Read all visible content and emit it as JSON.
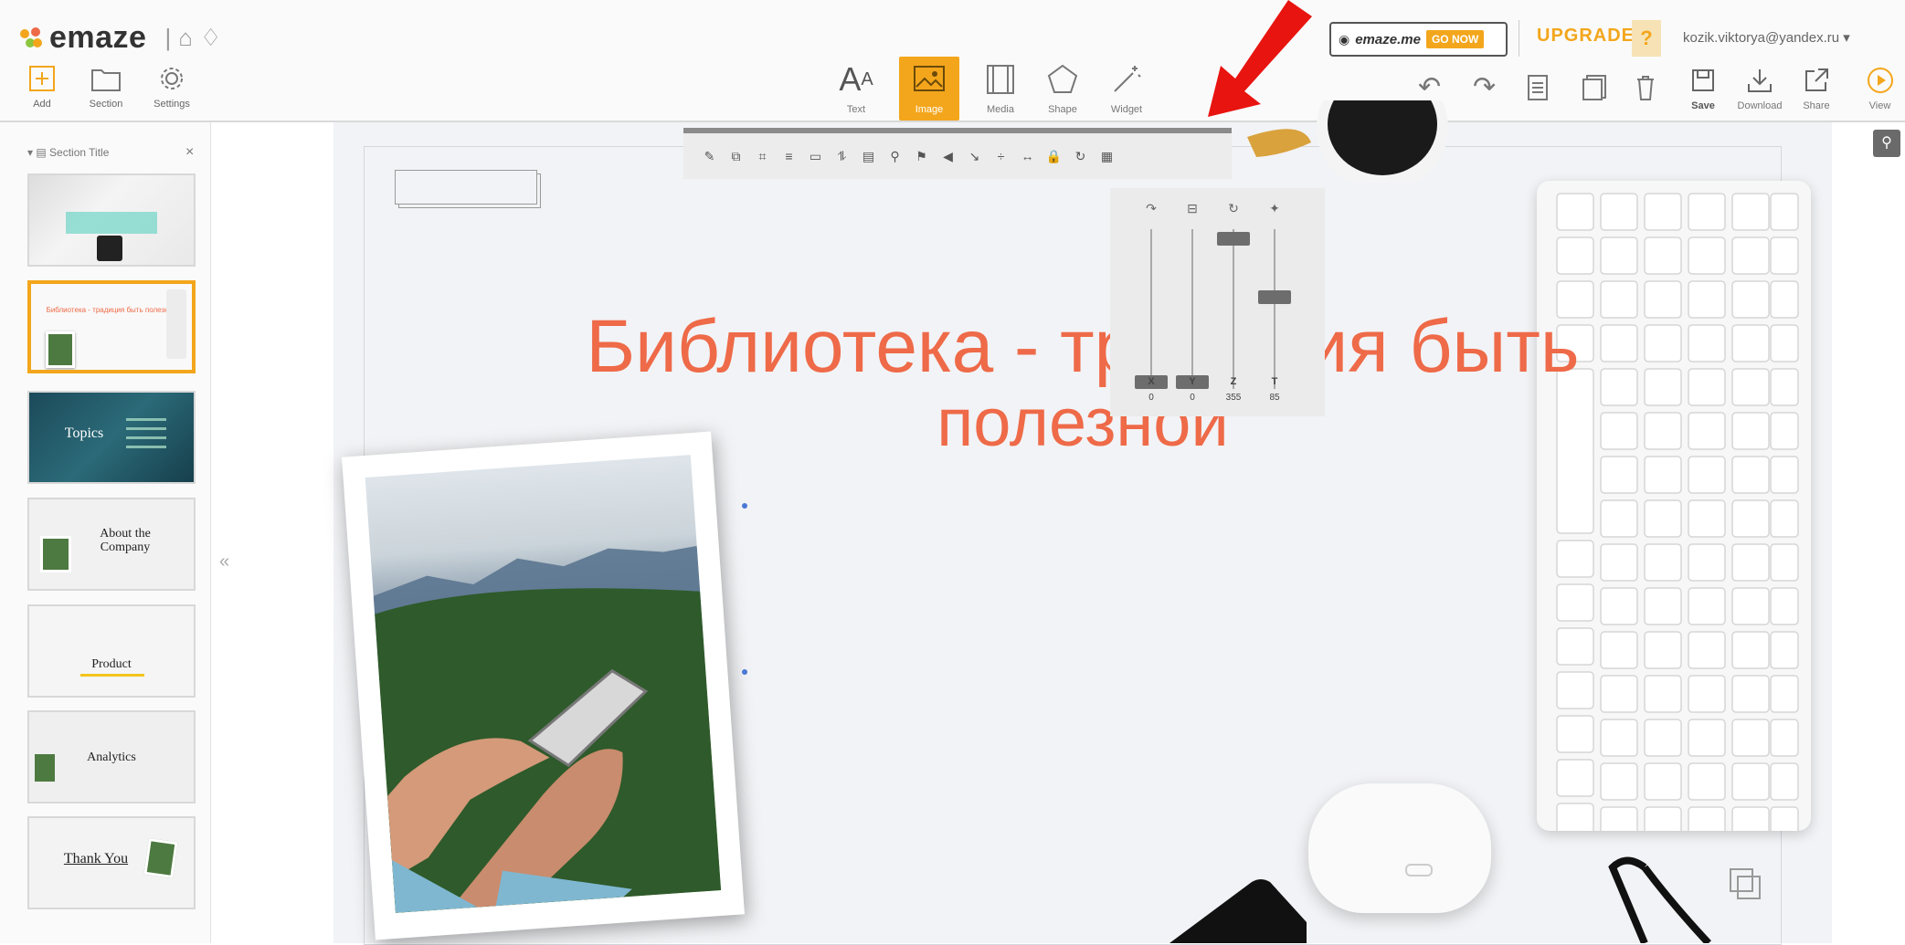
{
  "header": {
    "logo_text": "emaze",
    "left_tools": [
      {
        "label": "Add",
        "icon": "plus-square-icon"
      },
      {
        "label": "Section",
        "icon": "folder-icon"
      },
      {
        "label": "Settings",
        "icon": "gear-icon"
      }
    ],
    "center_tools": [
      {
        "label": "Text",
        "icon": "text-aa-icon"
      },
      {
        "label": "Image",
        "icon": "image-icon",
        "active": true
      },
      {
        "label": "Media",
        "icon": "film-icon"
      },
      {
        "label": "Shape",
        "icon": "pentagon-icon"
      },
      {
        "label": "Widget",
        "icon": "magic-wand-icon"
      }
    ],
    "right_tools": [
      {
        "label": "Save",
        "icon": "save-icon"
      },
      {
        "label": "Download",
        "icon": "download-icon"
      },
      {
        "label": "Share",
        "icon": "share-icon"
      },
      {
        "label": "View",
        "icon": "play-icon"
      }
    ],
    "promo": {
      "site": "emaze.me",
      "badge": "GO NOW"
    },
    "upgrade_label": "UPGRADE",
    "help_label": "?",
    "user_email": "kozik.viktorya@yandex.ru ▾",
    "accent_color": "#f3a61c"
  },
  "sidebar": {
    "section_title": "Section Title",
    "close_label": "×",
    "collapse_label": "«",
    "thumbnails": [
      {
        "text": ""
      },
      {
        "text": "Библиотека - традиция быть полезной",
        "selected": true
      },
      {
        "text": "Topics"
      },
      {
        "text": "About the Company"
      },
      {
        "text": "Product"
      },
      {
        "text": "Analytics"
      },
      {
        "text": "Thank You"
      }
    ]
  },
  "slide": {
    "title_line1": "Библиотека - традиция быть",
    "title_line2": "полезной",
    "title_color": "#ee6a48"
  },
  "edit_toolbar": {
    "icons": [
      "pencil-icon",
      "copy-icon",
      "crop-icon",
      "align-icon",
      "frame-icon",
      "text-wrap-icon",
      "layers-icon",
      "link-icon",
      "flag-icon",
      "sound-icon",
      "cursor-icon",
      "distribute-icon",
      "spacing-icon",
      "lock-icon",
      "rotate-icon",
      "grid-icon"
    ]
  },
  "sliders": [
    {
      "label": "X",
      "value": 0,
      "icon": "rotate-x-icon"
    },
    {
      "label": "Y",
      "value": 0,
      "icon": "rotate-y-icon"
    },
    {
      "label": "Z",
      "value": 355,
      "icon": "rotate-z-icon"
    },
    {
      "label": "T",
      "value": 85,
      "icon": "transparency-icon"
    }
  ],
  "slider_levels": [
    0.0,
    0.0,
    0.98,
    0.58
  ]
}
